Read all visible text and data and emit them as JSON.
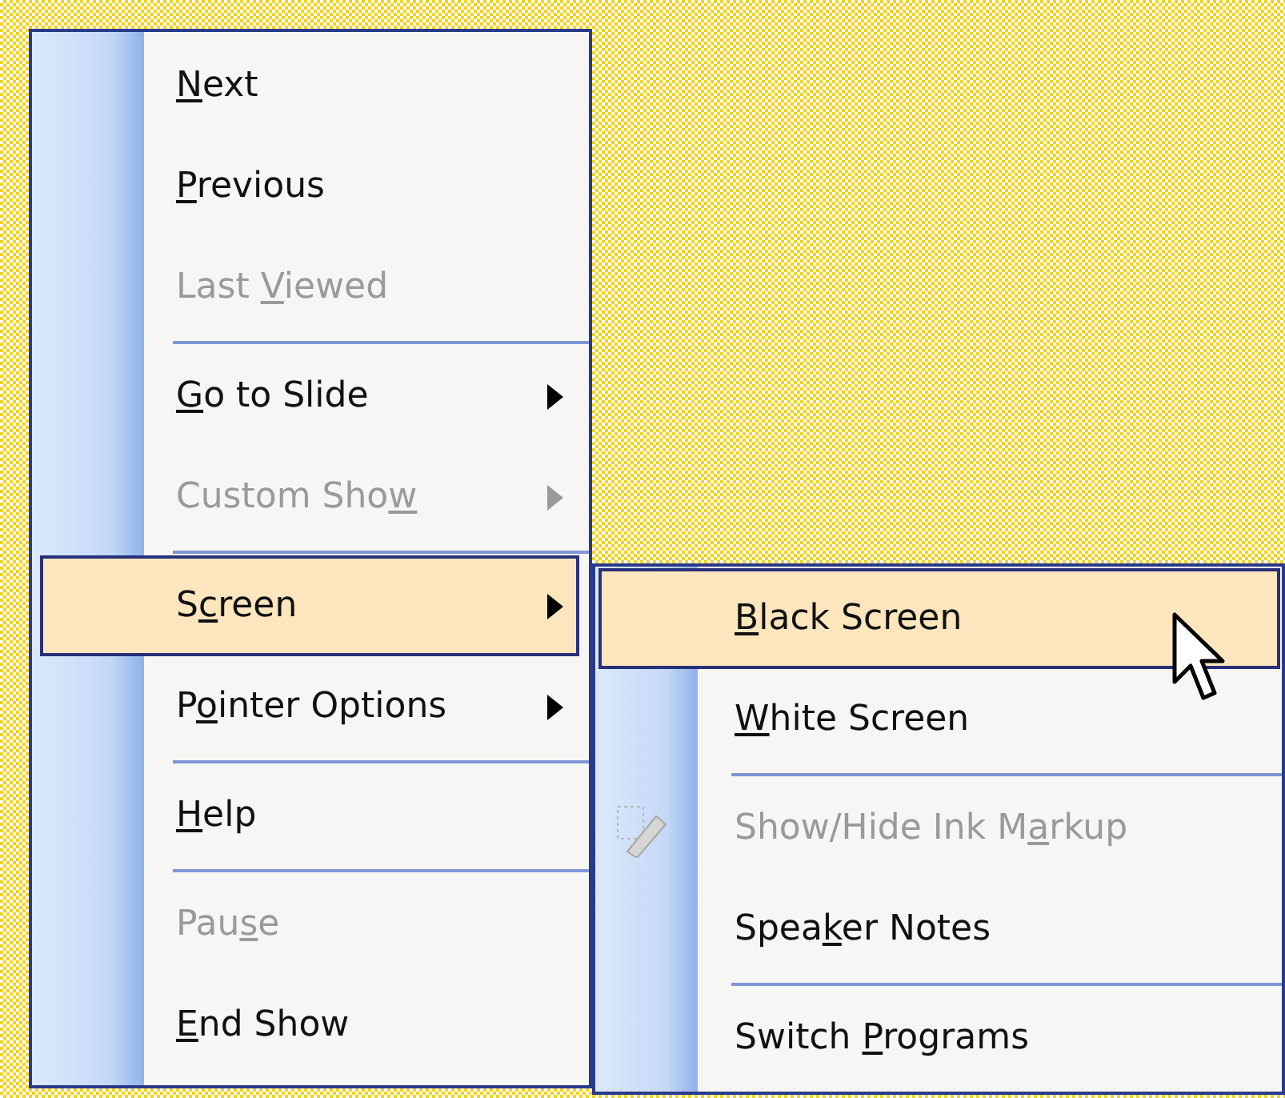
{
  "menu": {
    "items": [
      {
        "kind": "item",
        "label": {
          "key": "N",
          "after": "ext"
        },
        "disabled": false,
        "selected": false,
        "has_submenu": false
      },
      {
        "kind": "item",
        "label": {
          "key": "P",
          "after": "revious"
        },
        "disabled": false,
        "selected": false,
        "has_submenu": false
      },
      {
        "kind": "item",
        "label": {
          "before": "Last ",
          "key": "V",
          "after": "iewed"
        },
        "disabled": true,
        "selected": false,
        "has_submenu": false
      },
      {
        "kind": "separator"
      },
      {
        "kind": "item",
        "label": {
          "key": "G",
          "after": "o to Slide"
        },
        "disabled": false,
        "selected": false,
        "has_submenu": true
      },
      {
        "kind": "item",
        "label": {
          "before": "Custom Sho",
          "key": "w"
        },
        "disabled": true,
        "selected": false,
        "has_submenu": true
      },
      {
        "kind": "separator"
      },
      {
        "kind": "item",
        "label": {
          "before": "S",
          "key": "c",
          "after": "reen"
        },
        "disabled": false,
        "selected": true,
        "has_submenu": true,
        "submenu": {
          "items": [
            {
              "kind": "item",
              "label": {
                "key": "B",
                "after": "lack Screen"
              },
              "disabled": false,
              "selected": true,
              "has_submenu": false
            },
            {
              "kind": "item",
              "label": {
                "key": "W",
                "after": "hite Screen"
              },
              "disabled": false,
              "selected": false,
              "has_submenu": false
            },
            {
              "kind": "separator"
            },
            {
              "kind": "item",
              "label": {
                "before": "Show/Hide Ink M",
                "key": "a",
                "after": "rkup"
              },
              "disabled": true,
              "selected": false,
              "has_submenu": false,
              "icon": true
            },
            {
              "kind": "item",
              "label": {
                "before": "Spea",
                "key": "k",
                "after": "er Notes"
              },
              "disabled": false,
              "selected": false,
              "has_submenu": false
            },
            {
              "kind": "separator"
            },
            {
              "kind": "item",
              "label": {
                "before": "Switch ",
                "key": "P",
                "after": "rograms"
              },
              "disabled": false,
              "selected": false,
              "has_submenu": false
            }
          ]
        }
      },
      {
        "kind": "item",
        "label": {
          "before": "P",
          "key": "o",
          "after": "inter Options"
        },
        "disabled": false,
        "selected": false,
        "has_submenu": true
      },
      {
        "kind": "separator"
      },
      {
        "kind": "item",
        "label": {
          "key": "H",
          "after": "elp"
        },
        "disabled": false,
        "selected": false,
        "has_submenu": false
      },
      {
        "kind": "separator"
      },
      {
        "kind": "item",
        "label": {
          "before": "Pau",
          "key": "s",
          "after": "e"
        },
        "disabled": true,
        "selected": false,
        "has_submenu": false
      },
      {
        "kind": "item",
        "label": {
          "key": "E",
          "after": "nd Show"
        },
        "disabled": false,
        "selected": false,
        "has_submenu": false
      }
    ]
  }
}
